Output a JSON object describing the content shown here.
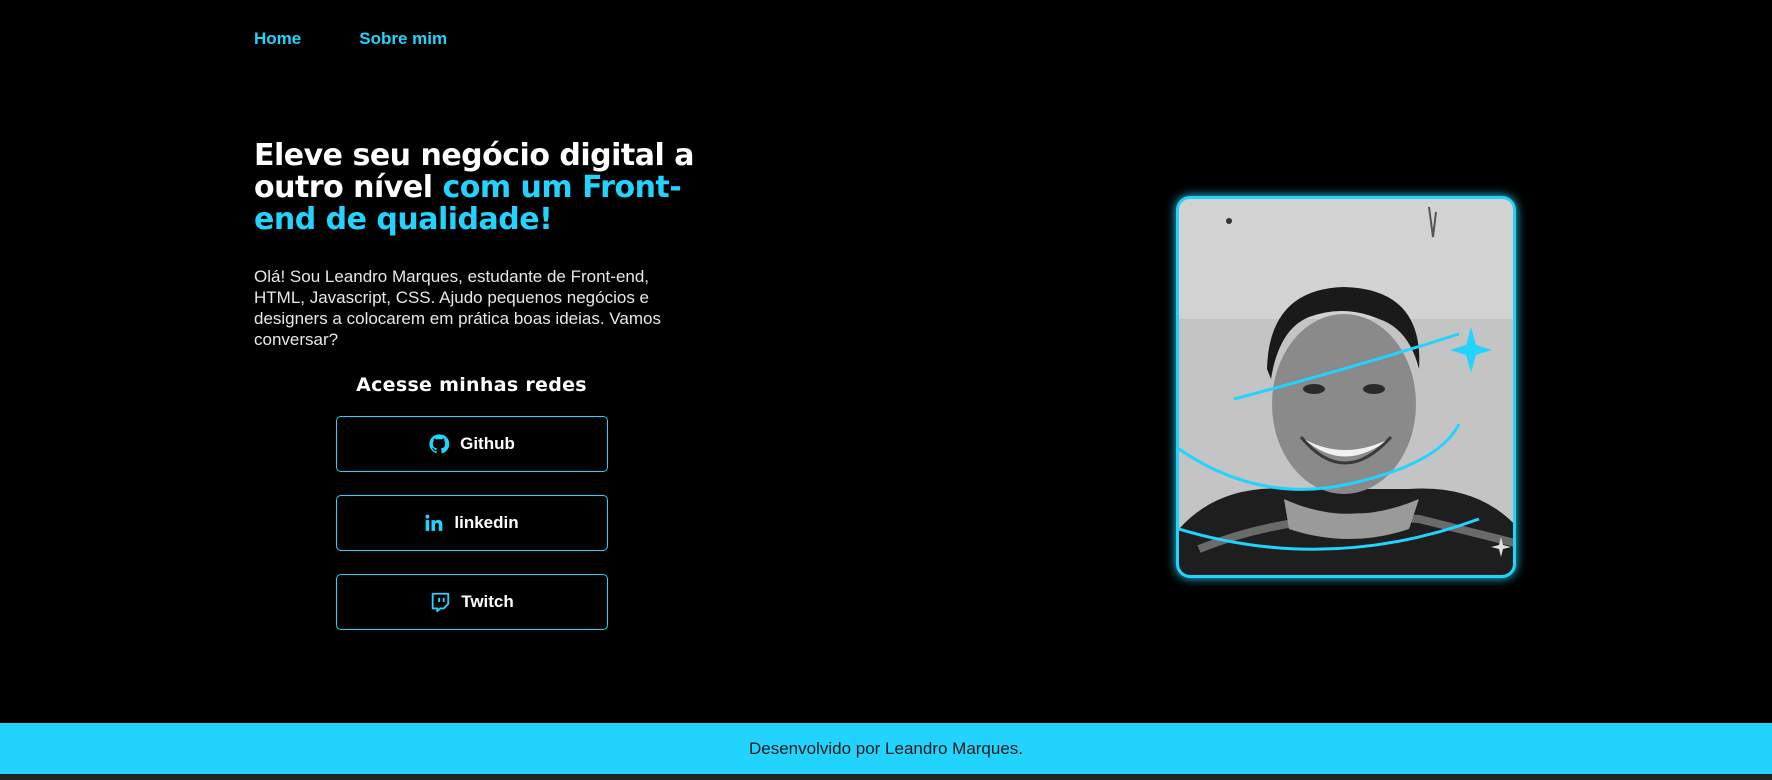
{
  "nav": {
    "home": "Home",
    "about": "Sobre mim"
  },
  "hero": {
    "title_white": "Eleve seu negócio digital a outro nível",
    "title_accent": "com um Front-end de qualidade!",
    "intro": "Olá! Sou Leandro Marques, estudante de Front-end, HTML, Javascript, CSS. Ajudo pequenos negócios e designers a colocarem em prática boas ideias. Vamos conversar?"
  },
  "social": {
    "title": "Acesse minhas redes",
    "items": [
      {
        "label": "Github",
        "icon": "github-icon"
      },
      {
        "label": "linkedin",
        "icon": "linkedin-icon"
      },
      {
        "label": "Twitch",
        "icon": "twitch-icon"
      }
    ]
  },
  "footer": {
    "text": "Desenvolvido por Leandro Marques."
  },
  "colors": {
    "accent": "#22d4fd",
    "background": "#000000",
    "footer_text": "#1a1a1a"
  }
}
